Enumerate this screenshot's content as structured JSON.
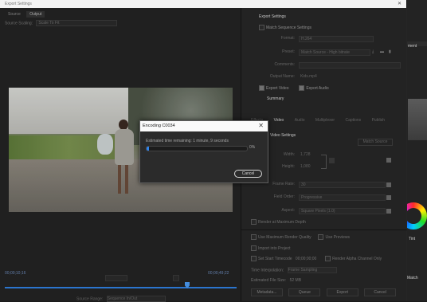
{
  "window": {
    "title": "Export Settings",
    "close_glyph": "✕"
  },
  "left": {
    "tabs": [
      "Source",
      "Output"
    ],
    "source_scaling_label": "Source Scaling:",
    "source_scaling_value": "Scale To Fit",
    "timecode_start": "00;00;10;16",
    "timecode_end": "00;00;49;22",
    "source_range_label": "Source Range:",
    "source_range_value": "Sequence In/Out"
  },
  "panel": {
    "export_settings_title": "Export Settings",
    "match_sequence_label": "Match Sequence Settings",
    "format_label": "Format:",
    "format_value": "H.264",
    "preset_label": "Preset:",
    "preset_value": "Match Source - High bitrate",
    "comments_label": "Comments:",
    "output_name_label": "Output Name:",
    "output_name_value": "Kids.mp4",
    "export_video_label": "Export Video",
    "export_audio_label": "Export Audio",
    "summary_title": "Summary",
    "tabs": [
      "Effects",
      "Video",
      "Audio",
      "Multiplexer",
      "Captions",
      "Publish"
    ],
    "video_settings_title": "Video Settings",
    "match_source_btn": "Match Source",
    "width_label": "Width:",
    "width_value": "1,728",
    "height_label": "Height:",
    "height_value": "1,080",
    "frame_rate_label": "Frame Rate:",
    "frame_rate_value": "30",
    "field_order_label": "Field Order:",
    "field_order_value": "Progressive",
    "aspect_label": "Aspect:",
    "aspect_value": "Square Pixels (1.0)",
    "render_max_depth": "Render at Maximum Depth",
    "use_max_render_quality": "Use Maximum Render Quality",
    "use_previews": "Use Previews",
    "import_into_project": "Import into Project",
    "set_start_timecode": "Set Start Timecode",
    "start_timecode_value": "00;00;00;00",
    "render_alpha_only": "Render Alpha Channel Only",
    "time_interpolation_label": "Time Interpolation:",
    "time_interpolation_value": "Frame Sampling",
    "est_file_size_label": "Estimated File Size:",
    "est_file_size_value": "52 MB",
    "buttons": [
      "Metadata...",
      "Queue",
      "Export",
      "Cancel"
    ]
  },
  "background_app": {
    "tint_label": "Tint",
    "match_label": "Match",
    "ment_label": "ment"
  },
  "dialog": {
    "title": "Encoding C0034",
    "close_glyph": "✕",
    "time_remaining": "Estimated time remaining: 1 minute, 9 seconds",
    "percent_text": "0%",
    "progress": 0.01,
    "cancel_label": "Cancel"
  },
  "colors": {
    "accent": "#2f86f0",
    "dialog_bg": "#2b2b2b",
    "title_bg": "#fafafa"
  }
}
